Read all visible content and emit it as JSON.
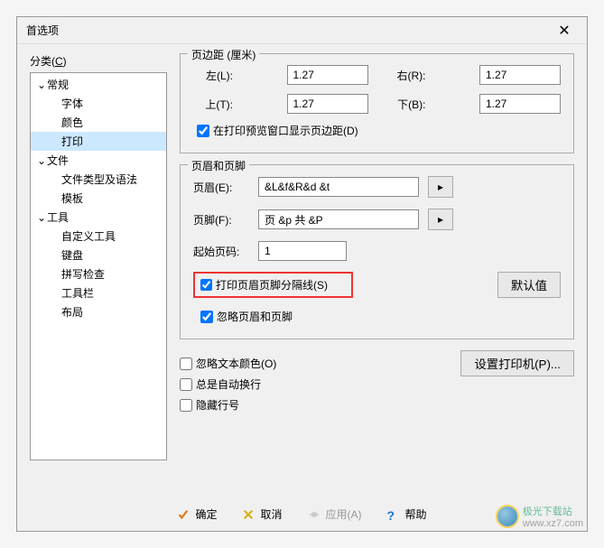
{
  "dialog": {
    "title": "首选项"
  },
  "category": {
    "label_prefix": "分类(",
    "label_u": "C",
    "label_suffix": ")",
    "tree": {
      "general": "常规",
      "font": "字体",
      "color": "颜色",
      "print": "打印",
      "file": "文件",
      "filetype": "文件类型及语法",
      "template": "模板",
      "tool": "工具",
      "customtool": "自定义工具",
      "keyboard": "键盘",
      "spellcheck": "拼写检查",
      "toolbar": "工具栏",
      "layout": "布局"
    }
  },
  "margins": {
    "legend": "页边距 (厘米)",
    "left": {
      "label_prefix": "左(",
      "u": "L",
      "suffix": "):",
      "value": "1.27"
    },
    "right": {
      "label_prefix": "右(",
      "u": "R",
      "suffix": "):",
      "value": "1.27"
    },
    "top": {
      "label_prefix": "上(",
      "u": "T",
      "suffix": "):",
      "value": "1.27"
    },
    "bottom": {
      "label_prefix": "下(",
      "u": "B",
      "suffix": "):",
      "value": "1.27"
    },
    "preview_cb": {
      "prefix": "在打印预览窗口显示页边距(",
      "u": "D",
      "suffix": ")"
    }
  },
  "hf": {
    "legend": "页眉和页脚",
    "header": {
      "label_prefix": "页眉(",
      "u": "E",
      "suffix": "):",
      "value": "&L&f&R&d &t"
    },
    "footer": {
      "label_prefix": "页脚(",
      "u": "F",
      "suffix": "):",
      "value": "页 &p 共 &P"
    },
    "startpage": {
      "label": "起始页码:",
      "value": "1"
    },
    "sep_cb": {
      "prefix": "打印页眉页脚分隔线(",
      "u": "S",
      "suffix": ")"
    },
    "ignore_cb": {
      "label": "忽略页眉和页脚"
    },
    "default_btn": "默认值"
  },
  "options": {
    "ignore_color": {
      "prefix": "忽略文本颜色(",
      "u": "O",
      "suffix": ")"
    },
    "wrap": "总是自动换行",
    "hideln": "隐藏行号",
    "printer_btn": {
      "prefix": "设置打印机(",
      "u": "P",
      "suffix": ")..."
    }
  },
  "footer": {
    "ok": "确定",
    "cancel": "取消",
    "apply": {
      "prefix": "应用(",
      "u": "A",
      "suffix": ")"
    },
    "help": "帮助"
  },
  "watermark": {
    "name": "极光下载站",
    "url": "www.xz7.com"
  }
}
